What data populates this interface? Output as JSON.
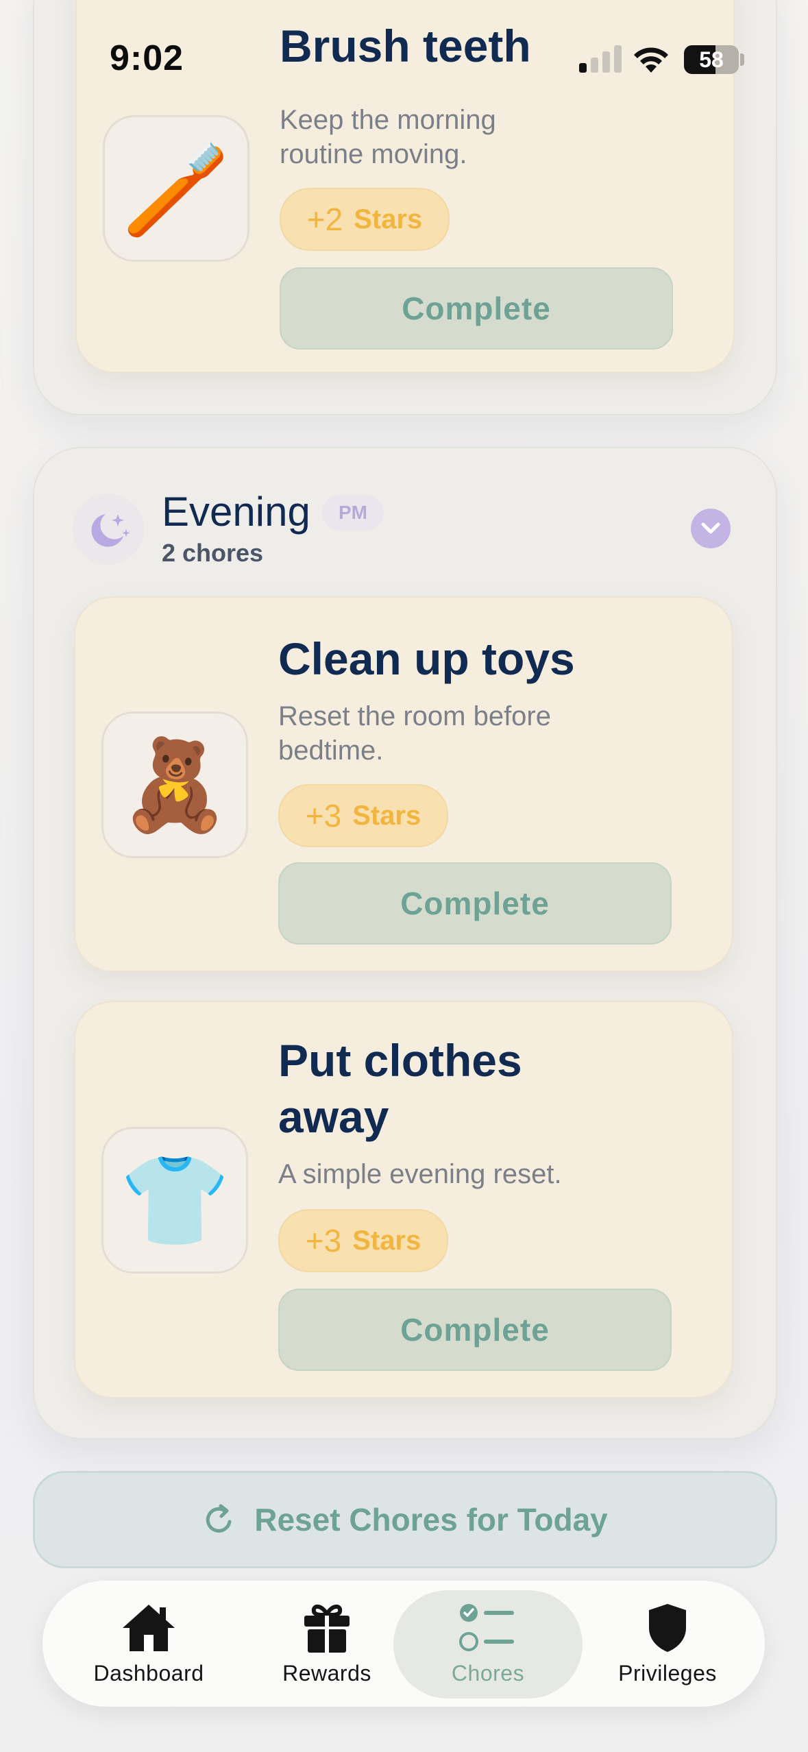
{
  "status_bar": {
    "time": "9:02",
    "battery": "58"
  },
  "sections": {
    "morning": {
      "chores": [
        {
          "title": "Brush teeth",
          "description": "Keep the morning routine moving.",
          "stars_amount": "+2",
          "stars_label": "Stars",
          "emoji": "🪥",
          "complete_label": "Complete"
        }
      ]
    },
    "evening": {
      "title": "Evening",
      "badge": "PM",
      "count": "2 chores",
      "chores": [
        {
          "title": "Clean up toys",
          "description": "Reset the room before bedtime.",
          "stars_amount": "+3",
          "stars_label": "Stars",
          "emoji": "🧸",
          "complete_label": "Complete"
        },
        {
          "title": "Put clothes away",
          "description": "A simple evening reset.",
          "stars_amount": "+3",
          "stars_label": "Stars",
          "emoji": "👕",
          "complete_label": "Complete"
        }
      ]
    }
  },
  "reset_button": {
    "label": "Reset Chores for Today"
  },
  "tab_bar": {
    "tabs": [
      {
        "label": "Dashboard",
        "icon": "house-icon"
      },
      {
        "label": "Rewards",
        "icon": "gift-icon"
      },
      {
        "label": "Chores",
        "icon": "checklist-icon",
        "active": true
      },
      {
        "label": "Privileges",
        "icon": "shield-icon"
      }
    ]
  },
  "colors": {
    "title": "#102a51",
    "accent_green": "#6da294",
    "star_gold": "#f2b53f",
    "evening_purple": "#c3b4e3",
    "card_bg": "#f5edde"
  }
}
